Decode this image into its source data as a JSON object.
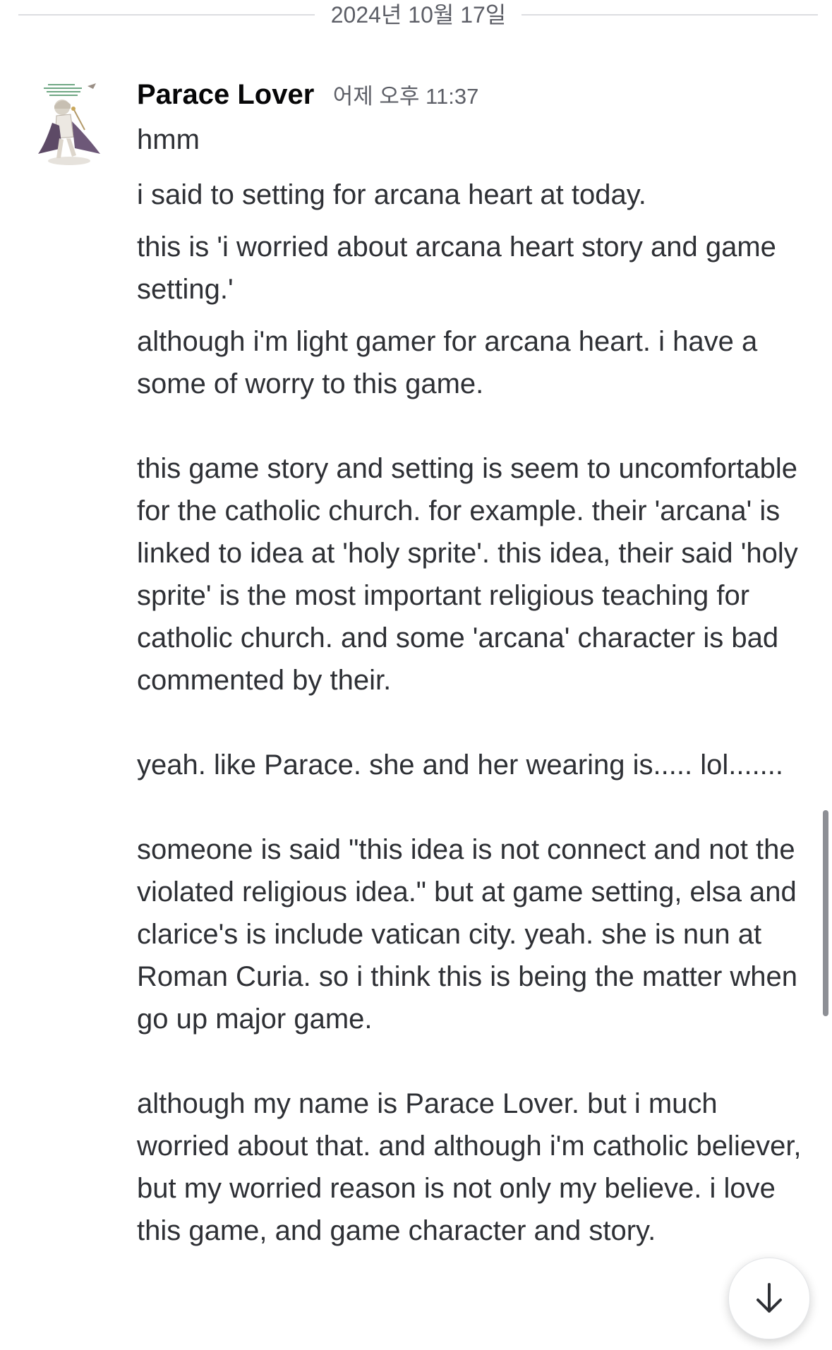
{
  "date_divider": {
    "label": "2024년 10월 17일"
  },
  "message": {
    "author": "Parace Lover",
    "timestamp": "어제 오후 11:37",
    "avatar_icon": "anime-character-avatar",
    "lines": [
      "hmm",
      "i said to setting for arcana heart at today.",
      "this is 'i worried about arcana heart story and game setting.'",
      "although i'm light gamer for arcana heart. i have a some of worry to this game.",
      "this game story and setting is seem to uncomfortable for the catholic church. for example. their 'arcana' is linked to idea at 'holy sprite'. this idea, their said 'holy sprite' is the most important religious teaching for catholic church. and some 'arcana' character is bad commented by their.",
      "yeah. like Parace. she and her wearing is..... lol.......",
      "someone is said \"this idea is not connect and not the violated religious idea.\" but at game setting, elsa and clarice's is include vatican city. yeah. she is nun at Roman Curia. so i think this is being the matter when go up major game.",
      "although my name is Parace Lover. but i much worried about that. and although i'm catholic believer, but my worried reason is not only my believe. i love this game, and game character and story."
    ]
  },
  "jump_button": {
    "icon": "arrow-down-icon"
  },
  "colors": {
    "background": "#ffffff",
    "text": "#2e3035",
    "username": "#060607",
    "muted": "#5c5e66",
    "divider": "#dcdde1"
  }
}
